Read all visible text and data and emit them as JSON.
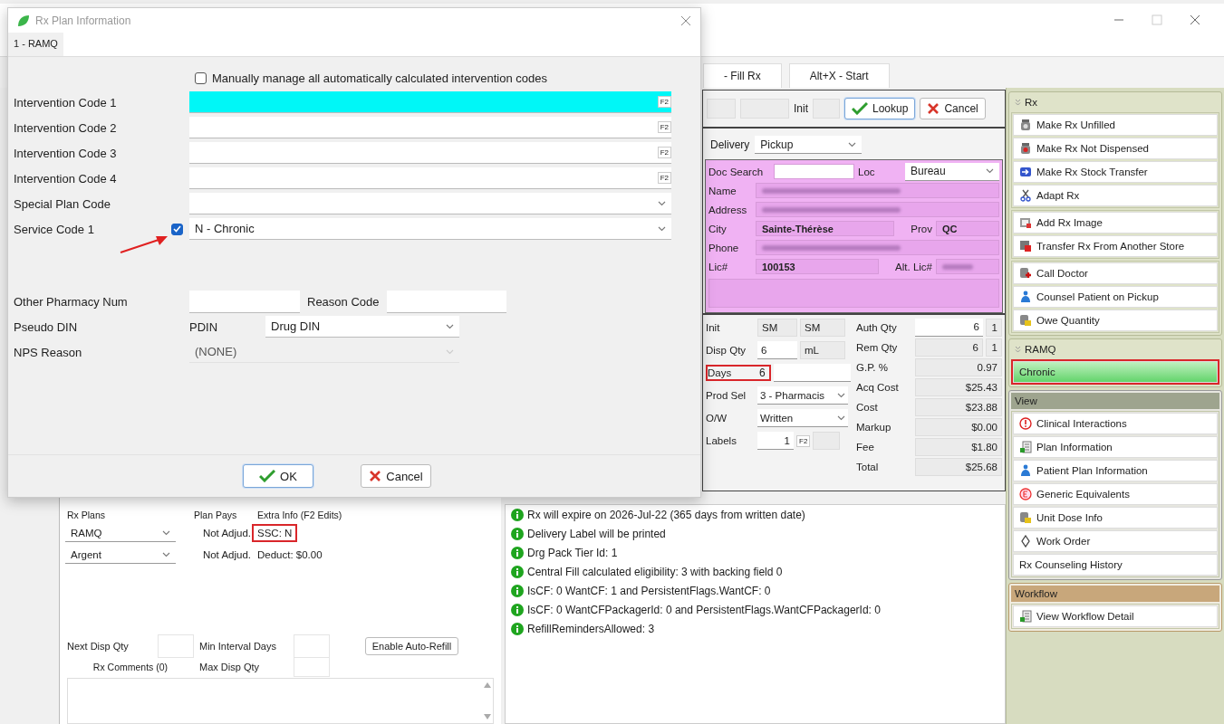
{
  "main_window": {
    "tabs": [
      {
        "label": "- Fill Rx",
        "selected": false
      },
      {
        "label": "Alt+X - Start",
        "selected": false
      }
    ]
  },
  "lookup": {
    "init_label": "Init",
    "buttons": [
      {
        "label": "Lookup",
        "kind": "ok"
      },
      {
        "label": "Cancel",
        "kind": "cancel"
      }
    ]
  },
  "delivery": {
    "label": "Delivery",
    "value": "Pickup"
  },
  "prescriber": {
    "search_label": "Doc Search",
    "loc_label": "Loc",
    "loc_value": "Bureau",
    "rows": [
      {
        "fields": [
          {
            "label": "Name",
            "redacted": true
          }
        ]
      },
      {
        "fields": [
          {
            "label": "Address",
            "redacted": true
          }
        ]
      },
      {
        "fields": [
          {
            "label": "City",
            "value": "Sainte-Thérèse",
            "redacted": false
          },
          {
            "label": "Prov",
            "value": "QC",
            "redacted": false
          }
        ]
      },
      {
        "fields": [
          {
            "label": "Phone",
            "redacted": true
          }
        ]
      },
      {
        "fields": [
          {
            "label": "Lic#",
            "value": "100153",
            "redacted": false
          },
          {
            "label": "Alt. Lic#",
            "redacted": true
          }
        ]
      }
    ]
  },
  "dispense": {
    "left": [
      {
        "label": "Init",
        "kind": "pair",
        "values": [
          "SM",
          "SM"
        ],
        "highlighted": false
      },
      {
        "label": "Disp Qty",
        "kind": "unit",
        "value": "6",
        "unit": "mL",
        "highlighted": false
      },
      {
        "label": "Days",
        "kind": "text",
        "value": "6",
        "highlighted": true
      },
      {
        "label": "Prod Sel",
        "kind": "dropdown",
        "value": "3 - Pharmacis",
        "highlighted": false
      },
      {
        "label": "O/W",
        "kind": "dropdown",
        "value": "Written",
        "highlighted": false
      },
      {
        "label": "Labels",
        "kind": "labels",
        "value": "1",
        "key": "F2",
        "highlighted": false
      }
    ],
    "right": [
      {
        "label": "Auth Qty",
        "value": "6",
        "extra": "1",
        "readonly": false
      },
      {
        "label": "Rem Qty",
        "value": "6",
        "extra": "1",
        "readonly": true
      },
      {
        "label": "G.P. %",
        "value": "0.97",
        "readonly": true
      },
      {
        "label": "Acq Cost",
        "value": "$25.43",
        "readonly": true
      },
      {
        "label": "Cost",
        "value": "$23.88",
        "readonly": true
      },
      {
        "label": "Markup",
        "value": "$0.00",
        "readonly": true
      },
      {
        "label": "Fee",
        "value": "$1.80",
        "readonly": true
      },
      {
        "label": "Total",
        "value": "$25.68",
        "readonly": true
      }
    ]
  },
  "actions": [
    {
      "title": "Rx",
      "kind": "actions",
      "sections": [
        {
          "items": [
            {
              "label": "Make Rx Unfilled",
              "highlighted": false
            },
            {
              "label": "Make Rx Not Dispensed",
              "highlighted": false
            },
            {
              "label": "Make Rx Stock Transfer",
              "highlighted": false
            },
            {
              "label": "Adapt Rx",
              "highlighted": false
            }
          ]
        },
        {
          "items": [
            {
              "label": "Add Rx Image",
              "highlighted": false
            },
            {
              "label": "Transfer Rx From Another Store",
              "highlighted": false
            }
          ]
        },
        {
          "items": [
            {
              "label": "Call Doctor",
              "highlighted": false
            },
            {
              "label": "Counsel Patient on Pickup",
              "highlighted": false
            },
            {
              "label": "Owe Quantity",
              "highlighted": false
            }
          ]
        }
      ]
    },
    {
      "title": "RAMQ",
      "kind": "plan",
      "sections": [
        {
          "items": [
            {
              "label": "Chronic",
              "highlighted": true
            }
          ]
        }
      ]
    },
    {
      "title": "View",
      "kind": "view",
      "sections": [
        {
          "items": [
            {
              "label": "Clinical Interactions",
              "highlighted": false
            },
            {
              "label": "Plan Information",
              "highlighted": false
            },
            {
              "label": "Patient Plan Information",
              "highlighted": false
            },
            {
              "label": "Generic Equivalents",
              "highlighted": false
            },
            {
              "label": "Unit Dose Info",
              "highlighted": false
            },
            {
              "label": "Work Order",
              "highlighted": false
            },
            {
              "label": "Rx Counseling History",
              "highlighted": false
            }
          ]
        }
      ]
    },
    {
      "title": "Workflow",
      "kind": "workflow",
      "sections": [
        {
          "items": [
            {
              "label": "View Workflow Detail",
              "highlighted": false
            }
          ]
        }
      ]
    }
  ],
  "plans": {
    "columns": [
      "Rx Plans",
      "Plan Pays",
      "Extra Info (F2 Edits)"
    ],
    "rows": [
      {
        "plan": "RAMQ",
        "pays": "Not Adjud.",
        "extra": "SSC: N",
        "highlighted": true
      },
      {
        "plan": "Argent",
        "pays": "Not Adjud.",
        "extra": "Deduct: $0.00",
        "highlighted": false
      }
    ],
    "next_disp_label": "Next Disp Qty",
    "min_interval_label": "Min Interval Days",
    "max_disp_label": "Max Disp Qty",
    "auto_refill_button": "Enable Auto-Refill",
    "comments_tab": "Rx Comments (0)"
  },
  "messages": [
    {
      "text": "Rx will expire on 2026-Jul-22 (365 days from written date)",
      "kind": "info"
    },
    {
      "text": "Delivery Label will be printed",
      "kind": "info"
    },
    {
      "text": "Drg Pack Tier Id: 1",
      "kind": "info"
    },
    {
      "text": "Central Fill calculated eligibility: 3 with backing field 0",
      "kind": "info"
    },
    {
      "text": "IsCF: 0 WantCF: 1 and PersistentFlags.WantCF: 0",
      "kind": "info"
    },
    {
      "text": "IsCF: 0 WantCFPackagerId: 0 and PersistentFlags.WantCFPackagerId: 0",
      "kind": "info"
    },
    {
      "text": "RefillRemindersAllowed: 3",
      "kind": "info"
    }
  ],
  "dialog": {
    "title": "Rx Plan Information",
    "tabs": [
      {
        "label": "1 - RAMQ",
        "selected": true
      }
    ],
    "manual_checkbox": {
      "label": "Manually manage all automatically calculated intervention codes",
      "checked": false
    },
    "code_rows": [
      {
        "label": "Intervention Code 1",
        "kind": "code",
        "key": "F2",
        "focused": true
      },
      {
        "label": "Intervention Code 2",
        "kind": "code",
        "key": "F2",
        "focused": false
      },
      {
        "label": "Intervention Code 3",
        "kind": "code",
        "key": "F2",
        "focused": false
      },
      {
        "label": "Intervention Code 4",
        "kind": "code",
        "key": "F2",
        "focused": false
      },
      {
        "label": "Special Plan Code",
        "kind": "dropdown",
        "focused": false
      },
      {
        "label": "Service Code 1",
        "kind": "checked_dropdown",
        "value": "N - Chronic",
        "checked": true,
        "arrow": true,
        "focused": false
      }
    ],
    "other_pharmacy": {
      "label": "Other Pharmacy Num",
      "reason_label": "Reason Code"
    },
    "pseudo_din": {
      "label": "Pseudo DIN",
      "prefix": "PDIN",
      "value": "Drug DIN"
    },
    "nps_reason": {
      "label": "NPS Reason",
      "value": "(NONE)",
      "disabled": true
    },
    "buttons": [
      {
        "label": "OK",
        "kind": "ok"
      },
      {
        "label": "Cancel",
        "kind": "cancel"
      }
    ]
  }
}
